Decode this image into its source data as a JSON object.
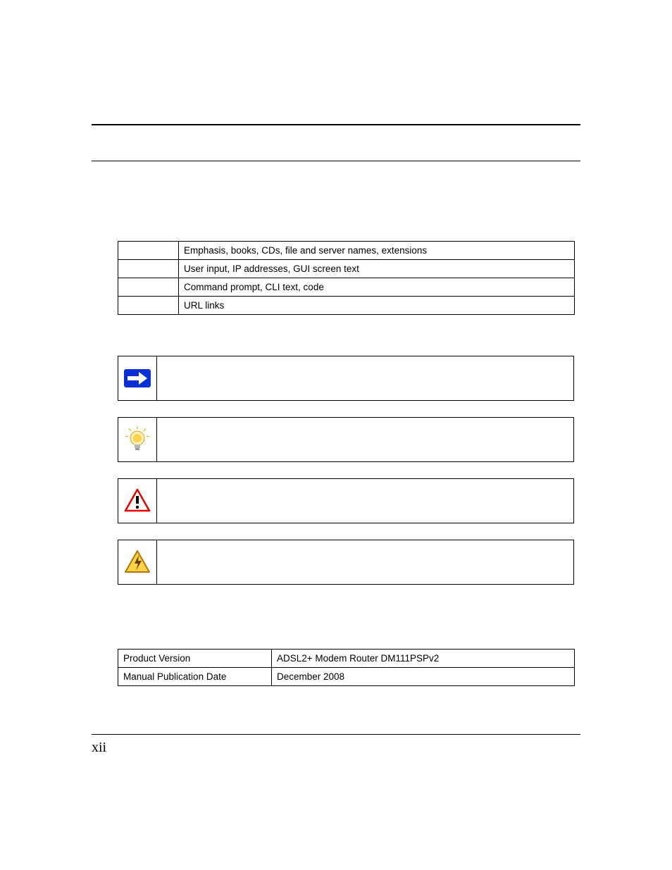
{
  "typography": {
    "rows": [
      {
        "col1": "",
        "col2": "Emphasis, books, CDs, file and server names, extensions"
      },
      {
        "col1": "",
        "col2": "User input, IP addresses, GUI screen text"
      },
      {
        "col1": "",
        "col2": "Command prompt, CLI text, code"
      },
      {
        "col1": "",
        "col2": "URL links"
      }
    ]
  },
  "callouts": {
    "items": [
      {
        "icon": "note",
        "text": ""
      },
      {
        "icon": "tip",
        "text": ""
      },
      {
        "icon": "warning",
        "text": ""
      },
      {
        "icon": "danger",
        "text": ""
      }
    ]
  },
  "info": {
    "rows": [
      {
        "label": "Product Version",
        "value": "ADSL2+ Modem Router DM111PSPv2"
      },
      {
        "label": "Manual Publication Date",
        "value": "December 2008"
      }
    ]
  },
  "footer": {
    "page_number": "xii"
  }
}
